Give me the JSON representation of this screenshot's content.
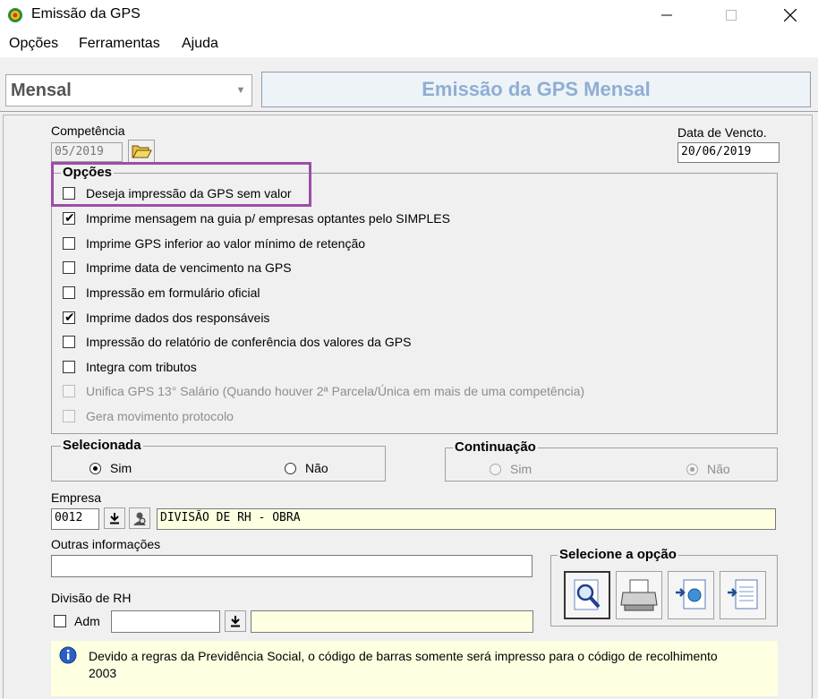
{
  "window": {
    "title": "Emissão da GPS"
  },
  "menu": [
    "Opções",
    "Ferramentas",
    "Ajuda"
  ],
  "header": {
    "mode_value": "Mensal",
    "banner": "Emissão da GPS Mensal"
  },
  "competencia": {
    "label": "Competência",
    "value": "05/2019"
  },
  "vencto": {
    "label": "Data de Vencto.",
    "value": "20/06/2019"
  },
  "opcoes": {
    "title": "Opções",
    "items": [
      {
        "label": "Deseja impressão da GPS sem valor",
        "checked": false,
        "enabled": true
      },
      {
        "label": "Imprime mensagem na guia p/ empresas optantes pelo SIMPLES",
        "checked": true,
        "enabled": true
      },
      {
        "label": "Imprime GPS inferior ao valor mínimo de retenção",
        "checked": false,
        "enabled": true
      },
      {
        "label": "Imprime data de vencimento na GPS",
        "checked": false,
        "enabled": true
      },
      {
        "label": "Impressão em formulário oficial",
        "checked": false,
        "enabled": true
      },
      {
        "label": "Imprime dados dos responsáveis",
        "checked": true,
        "enabled": true
      },
      {
        "label": "Impressão do relatório de conferência dos valores da GPS",
        "checked": false,
        "enabled": true
      },
      {
        "label": "Integra com tributos",
        "checked": false,
        "enabled": true
      },
      {
        "label": "Unifica GPS 13° Salário (Quando houver 2ª Parcela/Única em mais de uma competência)",
        "checked": false,
        "enabled": false
      },
      {
        "label": "Gera movimento protocolo",
        "checked": false,
        "enabled": false
      }
    ]
  },
  "selecionada": {
    "title": "Selecionada",
    "sim": "Sim",
    "nao": "Não",
    "selected": "Sim"
  },
  "continuacao": {
    "title": "Continuação",
    "sim": "Sim",
    "nao": "Não",
    "selected": "Não",
    "enabled": false
  },
  "empresa": {
    "label": "Empresa",
    "code": "0012",
    "name": "DIVISÃO DE RH - OBRA"
  },
  "outras": {
    "label": "Outras informações",
    "value": ""
  },
  "divisao": {
    "label": "Divisão de RH",
    "adm_label": "Adm",
    "adm_checked": false,
    "code": "",
    "name": ""
  },
  "acoes": {
    "title": "Selecione a opção"
  },
  "info": {
    "text": "Devido a regras da Previdência Social, o código de barras somente será impresso para o código de recolhimento 2003"
  },
  "colors": {
    "highlight": "#9b4ea8",
    "banner_text": "#8faed3",
    "info_bg": "#ffffe1"
  }
}
